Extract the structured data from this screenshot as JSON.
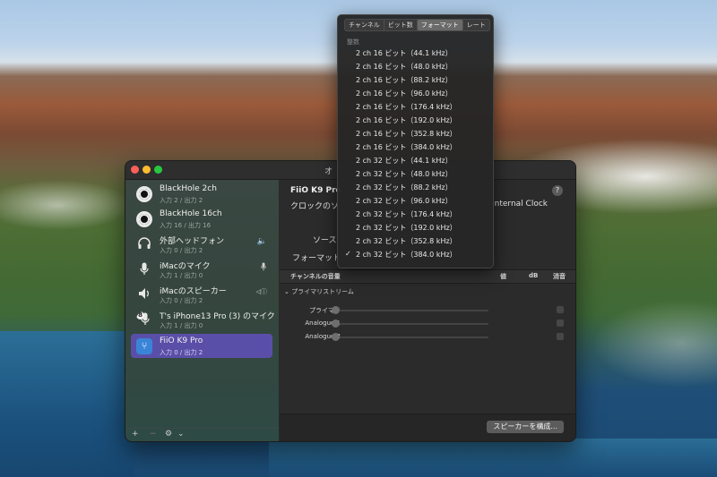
{
  "window": {
    "title": "オ"
  },
  "sidebar": {
    "devices": [
      {
        "name": "BlackHole 2ch",
        "sub": "入力 2 / 出力 2",
        "icon": "blackhole-icon",
        "right": ""
      },
      {
        "name": "BlackHole 16ch",
        "sub": "入力 16 / 出力 16",
        "icon": "blackhole-icon",
        "right": ""
      },
      {
        "name": "外部ヘッドフォン",
        "sub": "入力 0 / 出力 2",
        "icon": "headphones-icon",
        "right": "speaker-icon"
      },
      {
        "name": "iMacのマイク",
        "sub": "入力 1 / 出力 0",
        "icon": "microphone-icon",
        "right": "microphone-icon"
      },
      {
        "name": "iMacのスピーカー",
        "sub": "入力 0 / 出力 2",
        "icon": "speaker-icon",
        "right": "default-output-icon"
      },
      {
        "name": "T's iPhone13 Pro (3) のマイク",
        "sub": "入力 1 / 出力 0",
        "icon": "iphone-microphone-icon",
        "right": ""
      },
      {
        "name": "FiiO K9 Pro",
        "sub": "入力 0 / 出力 2",
        "icon": "usb-icon",
        "right": "",
        "selected": true
      }
    ],
    "footer": {
      "add": "+",
      "remove": "−",
      "gear": "⚙",
      "chevron": "⌄"
    }
  },
  "main": {
    "device_title": "FiiO K9 Pro",
    "clock_label": "クロックのソ",
    "clock_value": "Internal Clock",
    "help": "?",
    "source_label": "ソース",
    "format_label": "フォーマット",
    "volume_headers": {
      "channel": "チャンネルの音量",
      "value": "値",
      "db": "dB",
      "mute": "消音"
    },
    "stream": "プライマリストリーム",
    "channels": [
      "プライマリ",
      "Analogue 1",
      "Analogue 2"
    ],
    "configure_button": "スピーカーを構成..."
  },
  "menu": {
    "tabs": [
      "チャンネル",
      "ビット数",
      "フォーマット",
      "レート"
    ],
    "active_tab": "フォーマット",
    "section": "整数",
    "items": [
      "2 ch 16 ビット（44.1 kHz）",
      "2 ch 16 ビット（48.0 kHz）",
      "2 ch 16 ビット（88.2 kHz）",
      "2 ch 16 ビット（96.0 kHz）",
      "2 ch 16 ビット（176.4 kHz）",
      "2 ch 16 ビット（192.0 kHz）",
      "2 ch 16 ビット（352.8 kHz）",
      "2 ch 16 ビット（384.0 kHz）",
      "2 ch 32 ビット（44.1 kHz）",
      "2 ch 32 ビット（48.0 kHz）",
      "2 ch 32 ビット（88.2 kHz）",
      "2 ch 32 ビット（96.0 kHz）",
      "2 ch 32 ビット（176.4 kHz）",
      "2 ch 32 ビット（192.0 kHz）",
      "2 ch 32 ビット（352.8 kHz）",
      "2 ch 32 ビット（384.0 kHz）"
    ],
    "checked_index": 15,
    "checkmark": "✓"
  }
}
